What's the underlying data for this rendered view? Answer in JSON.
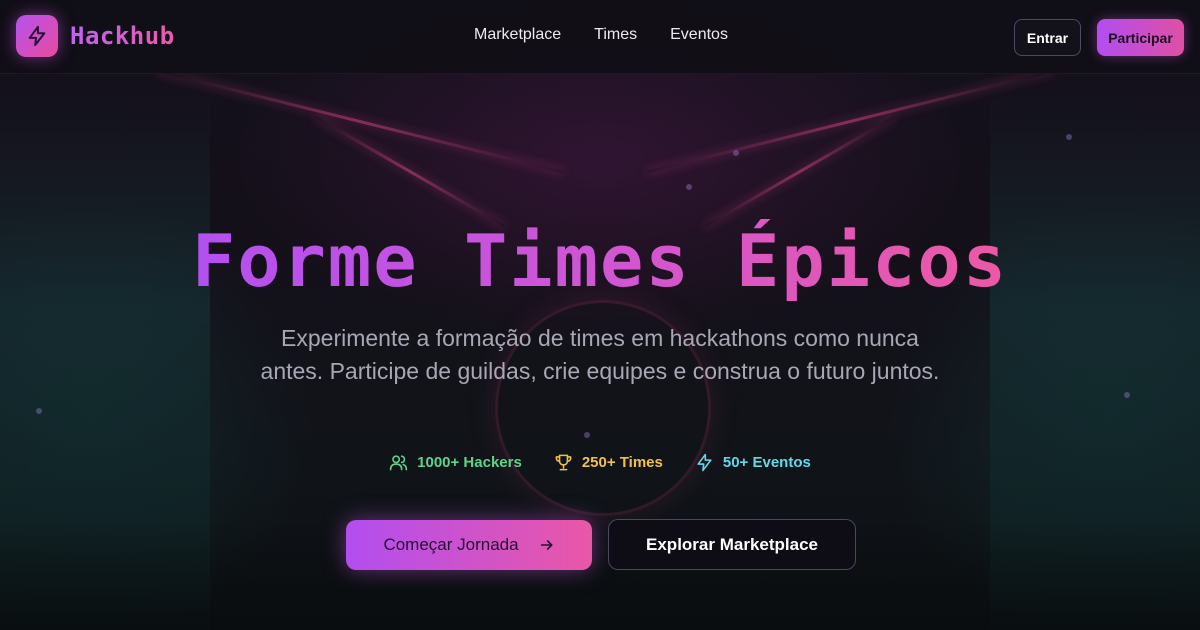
{
  "brand": {
    "name": "Hackhub",
    "logo_icon": "lightning-bolt-icon",
    "gradient_start": "#b452f0",
    "gradient_end": "#e94b9c"
  },
  "nav": {
    "links": [
      {
        "label": "Marketplace"
      },
      {
        "label": "Times"
      },
      {
        "label": "Eventos"
      }
    ],
    "login_label": "Entrar",
    "signup_label": "Participar"
  },
  "hero": {
    "title": "Forme Times Épicos",
    "subtitle": "Experimente a formação de times em hackathons como nunca antes. Participe de guildas, crie equipes e construa o futuro juntos.",
    "stats": [
      {
        "icon": "users-icon",
        "label": "1000+ Hackers",
        "color": "#5fd38a"
      },
      {
        "icon": "trophy-icon",
        "label": "250+ Times",
        "color": "#f0c04a"
      },
      {
        "icon": "lightning-bolt-icon",
        "label": "50+ Eventos",
        "color": "#62d9e6"
      }
    ],
    "primary_cta": {
      "label": "Começar Jornada",
      "icon": "arrow-right-icon"
    },
    "secondary_cta": {
      "label": "Explorar Marketplace"
    }
  }
}
